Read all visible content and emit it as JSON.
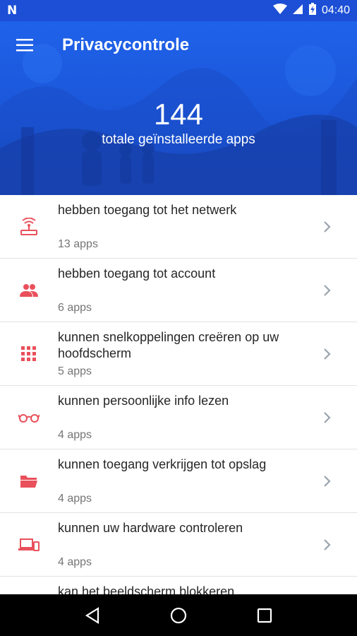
{
  "status_bar": {
    "time": "04:40",
    "logo": "N"
  },
  "app_bar": {
    "title": "Privacycontrole"
  },
  "hero": {
    "count": "144",
    "subtitle": "totale geïnstalleerde apps"
  },
  "colors": {
    "accent": "#1c4fd6",
    "icon": "#e9505b",
    "chevron": "#9aa3ad"
  },
  "items": [
    {
      "title": "hebben toegang tot het netwerk",
      "count": "13 apps",
      "icon": "network-icon"
    },
    {
      "title": "hebben toegang tot account",
      "count": "6 apps",
      "icon": "people-icon"
    },
    {
      "title": "kunnen snelkoppelingen creëren op uw hoofdscherm",
      "count": "5 apps",
      "icon": "grid-icon"
    },
    {
      "title": "kunnen persoonlijke info lezen",
      "count": "4 apps",
      "icon": "glasses-icon"
    },
    {
      "title": "kunnen toegang verkrijgen tot opslag",
      "count": "4 apps",
      "icon": "folder-icon"
    },
    {
      "title": "kunnen uw hardware controleren",
      "count": "4 apps",
      "icon": "devices-icon"
    },
    {
      "title": "kan het beeldscherm blokkeren",
      "count": "",
      "icon": "lock-icon"
    }
  ]
}
